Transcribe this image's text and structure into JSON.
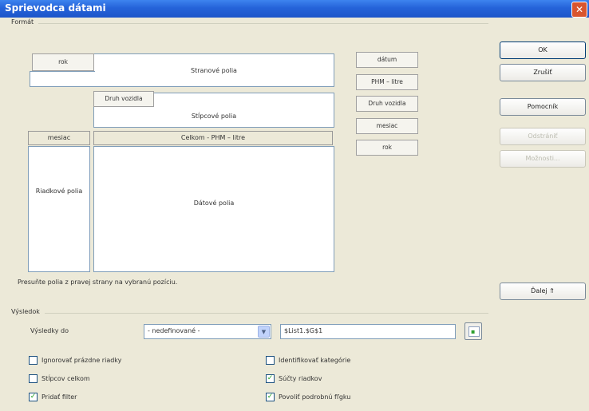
{
  "window": {
    "title": "Sprievodca dátami"
  },
  "layout_section": {
    "title": "Formát",
    "page_field_button": "rok",
    "page_area_label": "Stranové polia",
    "column_field_button": "Druh vozidla",
    "column_area_label": "Stĺpcové polia",
    "row_header": "mesiac",
    "data_header": "Celkom - PHM – litre",
    "row_area_label": "Riadkové polia",
    "data_area_label": "Dátové polia",
    "available_fields": [
      "dátum",
      "PHM – litre",
      "Druh vozidla",
      "mesiac",
      "rok"
    ],
    "hint": "Presuňte polia z pravej strany na vybranú pozíciu."
  },
  "buttons": {
    "ok": "OK",
    "cancel": "Zrušiť",
    "help": "Pomocník",
    "remove": "Odstrániť",
    "options": "Možnosti...",
    "more": "Ďalej ⇑"
  },
  "result_section": {
    "title": "Výsledok",
    "results_to_label": "Výsledky do",
    "results_to_value": "- nedefinované -",
    "results_to_address": "$List1.$G$1",
    "checkboxes": [
      {
        "label": "Ignorovať prázdne riadky",
        "checked": false
      },
      {
        "label": "Identifikovať kategórie",
        "checked": false
      },
      {
        "label": "Stĺpcov celkom",
        "checked": false
      },
      {
        "label": "Súčty riadkov",
        "checked": true
      },
      {
        "label": "Pridať filter",
        "checked": true
      },
      {
        "label": "Povoliť podrobnú fľgku",
        "checked": true
      }
    ]
  },
  "colors": {
    "titlebar": "#2563d9",
    "dialog_bg": "#ece9d8",
    "check_mark": "#21a121"
  }
}
